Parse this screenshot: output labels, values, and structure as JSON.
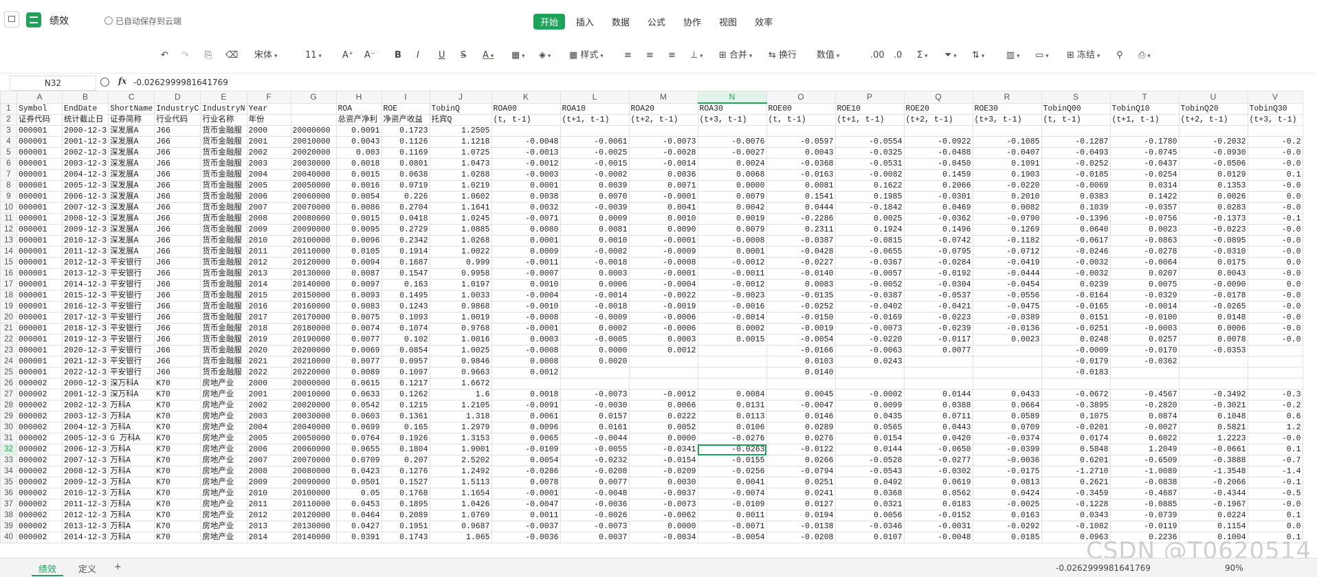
{
  "doc": {
    "title": "绩效",
    "save_status": "已自动保存到云端"
  },
  "menu": [
    "开始",
    "插入",
    "数据",
    "公式",
    "协作",
    "视图",
    "效率"
  ],
  "toolbar": {
    "font": "宋体",
    "size": "11",
    "style": "样式",
    "merge": "合并",
    "wrap": "换行",
    "format": "数值",
    "freeze": "冻结"
  },
  "formula": {
    "cell": "N32",
    "value": "-0.0262999981641769"
  },
  "columns": [
    "A",
    "B",
    "C",
    "D",
    "E",
    "F",
    "G",
    "H",
    "I",
    "J",
    "K",
    "L",
    "M",
    "N",
    "O",
    "P",
    "Q",
    "R",
    "S",
    "T",
    "U",
    "V"
  ],
  "rows": [
    [
      "1",
      "Symbol",
      "EndDate",
      "ShortName",
      "IndustryC",
      "IndustryN",
      "Year",
      "",
      "ROA",
      "ROE",
      "TobinQ",
      "ROA00",
      "ROA10",
      "ROA20",
      "ROA30",
      "ROE00",
      "ROE10",
      "ROE20",
      "ROE30",
      "TobinQ00",
      "TobinQ10",
      "TobinQ20",
      "TobinQ30"
    ],
    [
      "2",
      "证券代码",
      "统计截止日",
      "证券简称",
      "行业代码",
      "行业名称",
      "年份",
      "",
      "总资产净利",
      "净资产收益",
      "托宾Q",
      "(t, t-1)",
      "(t+1, t-1)",
      "(t+2, t-1)",
      "(t+3, t-1)",
      "(t, t-1)",
      "(t+1, t-1)",
      "(t+2, t-1)",
      "(t+3, t-1)",
      "(t, t-1)",
      "(t+1, t-1)",
      "(t+2, t-1)",
      "(t+3, t-1)"
    ],
    [
      "3",
      "000001",
      "2000-12-3",
      "深发展A",
      "J66",
      "货币金融服",
      "2000",
      "20000000",
      "0.0091",
      "0.1723",
      "1.2505",
      "",
      "",
      "",
      "",
      "",
      "",
      "",
      "",
      "",
      "",
      "",
      ""
    ],
    [
      "4",
      "000001",
      "2001-12-3",
      "深发展A",
      "J66",
      "货币金融服",
      "2001",
      "20010000",
      "0.0043",
      "0.1126",
      "1.1218",
      "-0.0048",
      "-0.0061",
      "-0.0073",
      "-0.0076",
      "-0.0597",
      "-0.0554",
      "-0.0922",
      "-0.1085",
      "-0.1287",
      "-0.1780",
      "-0.2032",
      "-0.2"
    ],
    [
      "5",
      "000001",
      "2002-12-3",
      "深发展A",
      "J66",
      "货币金融服",
      "2002",
      "20020000",
      "0.003",
      "0.1169",
      "1.0725",
      "-0.0013",
      "-0.0025",
      "-0.0028",
      "-0.0027",
      "0.0043",
      "-0.0325",
      "-0.0488",
      "-0.0407",
      "-0.0493",
      "-0.0745",
      "-0.0930",
      "-0.0"
    ],
    [
      "6",
      "000001",
      "2003-12-3",
      "深发展A",
      "J66",
      "货币金融服",
      "2003",
      "20030000",
      "0.0018",
      "0.0801",
      "1.0473",
      "-0.0012",
      "-0.0015",
      "-0.0014",
      "0.0024",
      "-0.0368",
      "-0.0531",
      "-0.0450",
      "0.1091",
      "-0.0252",
      "-0.0437",
      "-0.0506",
      "-0.0"
    ],
    [
      "7",
      "000001",
      "2004-12-3",
      "深发展A",
      "J66",
      "货币金融服",
      "2004",
      "20040000",
      "0.0015",
      "0.0638",
      "1.0288",
      "-0.0003",
      "-0.0002",
      "0.0036",
      "0.0068",
      "-0.0163",
      "-0.0082",
      "0.1459",
      "0.1903",
      "-0.0185",
      "-0.0254",
      "0.0129",
      "0.1"
    ],
    [
      "8",
      "000001",
      "2005-12-3",
      "深发展A",
      "J66",
      "货币金融服",
      "2005",
      "20050000",
      "0.0016",
      "0.0719",
      "1.0219",
      "0.0001",
      "0.0039",
      "0.0071",
      "0.0000",
      "0.0081",
      "0.1622",
      "0.2066",
      "-0.0220",
      "-0.0069",
      "0.0314",
      "0.1353",
      "-0.0"
    ],
    [
      "9",
      "000001",
      "2006-12-3",
      "深发展A",
      "J66",
      "货币金融服",
      "2006",
      "20060000",
      "0.0054",
      "0.226",
      "1.0602",
      "0.0038",
      "0.0070",
      "-0.0001",
      "0.0079",
      "0.1541",
      "0.1985",
      "-0.0301",
      "0.2010",
      "0.0383",
      "0.1422",
      "0.0026",
      "0.0"
    ],
    [
      "10",
      "000001",
      "2007-12-3",
      "深发展A",
      "J66",
      "货币金融服",
      "2007",
      "20070000",
      "0.0086",
      "0.2704",
      "1.1641",
      "0.0032",
      "-0.0039",
      "0.0041",
      "0.0042",
      "0.0444",
      "-0.1842",
      "0.0469",
      "0.0082",
      "0.1039",
      "-0.0357",
      "0.0283",
      "-0.0"
    ],
    [
      "11",
      "000001",
      "2008-12-3",
      "深发展A",
      "J66",
      "货币金融服",
      "2008",
      "20080000",
      "0.0015",
      "0.0418",
      "1.0245",
      "-0.0071",
      "0.0009",
      "0.0010",
      "0.0019",
      "-0.2286",
      "0.0025",
      "-0.0362",
      "-0.0790",
      "-0.1396",
      "-0.0756",
      "-0.1373",
      "-0.1"
    ],
    [
      "12",
      "000001",
      "2009-12-3",
      "深发展A",
      "J66",
      "货币金融服",
      "2009",
      "20090000",
      "0.0095",
      "0.2729",
      "1.0885",
      "0.0080",
      "0.0081",
      "0.0090",
      "0.0079",
      "0.2311",
      "0.1924",
      "0.1496",
      "0.1269",
      "0.0640",
      "0.0023",
      "-0.0223",
      "-0.0"
    ],
    [
      "13",
      "000001",
      "2010-12-3",
      "深发展A",
      "J66",
      "货币金融服",
      "2010",
      "20100000",
      "0.0096",
      "0.2342",
      "1.0268",
      "0.0001",
      "0.0010",
      "-0.0001",
      "-0.0008",
      "-0.0387",
      "-0.0815",
      "-0.0742",
      "-0.1182",
      "-0.0617",
      "-0.0863",
      "-0.0895",
      "-0.0"
    ],
    [
      "14",
      "000001",
      "2011-12-3",
      "深发展A",
      "J66",
      "货币金融服",
      "2011",
      "20110000",
      "0.0105",
      "0.1914",
      "1.0022",
      "0.0009",
      "-0.0002",
      "-0.0009",
      "0.0001",
      "-0.0428",
      "-0.0655",
      "-0.0795",
      "-0.0712",
      "-0.0246",
      "-0.0278",
      "-0.0310",
      "-0.0"
    ],
    [
      "15",
      "000001",
      "2012-12-3",
      "平安银行",
      "J66",
      "货币金融服",
      "2012",
      "20120000",
      "0.0094",
      "0.1687",
      "0.999",
      "-0.0011",
      "-0.0018",
      "-0.0008",
      "-0.0012",
      "-0.0227",
      "-0.0367",
      "-0.0284",
      "-0.0419",
      "-0.0032",
      "-0.0064",
      "0.0175",
      "0.0"
    ],
    [
      "16",
      "000001",
      "2013-12-3",
      "平安银行",
      "J66",
      "货币金融服",
      "2013",
      "20130000",
      "0.0087",
      "0.1547",
      "0.9958",
      "-0.0007",
      "0.0003",
      "-0.0001",
      "-0.0011",
      "-0.0140",
      "-0.0057",
      "-0.0192",
      "-0.0444",
      "-0.0032",
      "0.0207",
      "0.0043",
      "-0.0"
    ],
    [
      "17",
      "000001",
      "2014-12-3",
      "平安银行",
      "J66",
      "货币金融服",
      "2014",
      "20140000",
      "0.0097",
      "0.163",
      "1.0197",
      "0.0010",
      "0.0006",
      "-0.0004",
      "-0.0012",
      "0.0083",
      "-0.0052",
      "-0.0304",
      "-0.0454",
      "0.0239",
      "0.0075",
      "-0.0090",
      "0.0"
    ],
    [
      "18",
      "000001",
      "2015-12-3",
      "平安银行",
      "J66",
      "货币金融服",
      "2015",
      "20150000",
      "0.0093",
      "0.1495",
      "1.0033",
      "-0.0004",
      "-0.0014",
      "-0.0022",
      "-0.0023",
      "-0.0135",
      "-0.0387",
      "-0.0537",
      "-0.0556",
      "-0.0164",
      "-0.0329",
      "-0.0178",
      "-0.0"
    ],
    [
      "19",
      "000001",
      "2016-12-3",
      "平安银行",
      "J66",
      "货币金融服",
      "2016",
      "20160000",
      "0.0083",
      "0.1243",
      "0.9868",
      "-0.0010",
      "-0.0018",
      "-0.0019",
      "-0.0016",
      "-0.0252",
      "-0.0402",
      "-0.0421",
      "-0.0475",
      "-0.0165",
      "-0.0014",
      "-0.0265",
      "-0.0"
    ],
    [
      "20",
      "000001",
      "2017-12-3",
      "平安银行",
      "J66",
      "货币金融服",
      "2017",
      "20170000",
      "0.0075",
      "0.1093",
      "1.0019",
      "-0.0008",
      "-0.0009",
      "-0.0006",
      "-0.0014",
      "-0.0150",
      "-0.0169",
      "-0.0223",
      "-0.0389",
      "0.0151",
      "-0.0100",
      "0.0148",
      "-0.0"
    ],
    [
      "21",
      "000001",
      "2018-12-3",
      "平安银行",
      "J66",
      "货币金融服",
      "2018",
      "20180000",
      "0.0074",
      "0.1074",
      "0.9768",
      "-0.0001",
      "0.0002",
      "-0.0006",
      "0.0002",
      "-0.0019",
      "-0.0073",
      "-0.0239",
      "-0.0136",
      "-0.0251",
      "-0.0003",
      "0.0006",
      "-0.0"
    ],
    [
      "22",
      "000001",
      "2019-12-3",
      "平安银行",
      "J66",
      "货币金融服",
      "2019",
      "20190000",
      "0.0077",
      "0.102",
      "1.0016",
      "0.0003",
      "-0.0005",
      "0.0003",
      "0.0015",
      "-0.0054",
      "-0.0220",
      "-0.0117",
      "0.0023",
      "0.0248",
      "0.0257",
      "0.0078",
      "-0.0"
    ],
    [
      "23",
      "000001",
      "2020-12-3",
      "平安银行",
      "J66",
      "货币金融服",
      "2020",
      "20200000",
      "0.0069",
      "0.0854",
      "1.0025",
      "-0.0008",
      "0.0000",
      "0.0012",
      "",
      "-0.0166",
      "-0.0063",
      "0.0077",
      "",
      "-0.0009",
      "-0.0170",
      "-0.0353",
      ""
    ],
    [
      "24",
      "000001",
      "2021-12-3",
      "平安银行",
      "J66",
      "货币金融服",
      "2021",
      "20210000",
      "0.0077",
      "0.0957",
      "0.9846",
      "0.0008",
      "0.0020",
      "",
      "",
      "0.0103",
      "0.0243",
      "",
      "",
      "-0.0179",
      "-0.0362",
      "",
      ""
    ],
    [
      "25",
      "000001",
      "2022-12-3",
      "平安银行",
      "J66",
      "货币金融服",
      "2022",
      "20220000",
      "0.0089",
      "0.1097",
      "0.9663",
      "0.0012",
      "",
      "",
      "",
      "0.0140",
      "",
      "",
      "",
      "-0.0183",
      "",
      "",
      ""
    ],
    [
      "26",
      "000002",
      "2000-12-3",
      "深万科A",
      "K70",
      "房地产业",
      "2000",
      "20000000",
      "0.0615",
      "0.1217",
      "1.6672",
      "",
      "",
      "",
      "",
      "",
      "",
      "",
      "",
      "",
      "",
      "",
      ""
    ],
    [
      "27",
      "000002",
      "2001-12-3",
      "深万科A",
      "K70",
      "房地产业",
      "2001",
      "20010000",
      "0.0633",
      "0.1262",
      "1.6",
      "0.0018",
      "-0.0073",
      "-0.0012",
      "0.0084",
      "0.0045",
      "-0.0002",
      "0.0144",
      "0.0433",
      "-0.0672",
      "-0.4567",
      "-0.3492",
      "-0.3"
    ],
    [
      "28",
      "000002",
      "2002-12-3",
      "万科A",
      "K70",
      "房地产业",
      "2002",
      "20020000",
      "0.0542",
      "0.1215",
      "1.2105",
      "-0.0091",
      "-0.0030",
      "0.0066",
      "0.0131",
      "-0.0047",
      "0.0099",
      "0.0388",
      "0.0664",
      "-0.3895",
      "-0.2820",
      "-0.3021",
      "-0.2"
    ],
    [
      "29",
      "000002",
      "2003-12-3",
      "万科A",
      "K70",
      "房地产业",
      "2003",
      "20030000",
      "0.0603",
      "0.1361",
      "1.318",
      "0.0061",
      "0.0157",
      "0.0222",
      "0.0113",
      "0.0146",
      "0.0435",
      "0.0711",
      "0.0589",
      "0.1075",
      "0.0874",
      "0.1048",
      "0.6"
    ],
    [
      "30",
      "000002",
      "2004-12-3",
      "万科A",
      "K70",
      "房地产业",
      "2004",
      "20040000",
      "0.0699",
      "0.165",
      "1.2979",
      "0.0096",
      "0.0161",
      "0.0052",
      "0.0106",
      "0.0289",
      "0.0565",
      "0.0443",
      "0.0709",
      "-0.0201",
      "-0.0027",
      "0.5821",
      "1.2"
    ],
    [
      "31",
      "000002",
      "2005-12-3",
      "G 万科A",
      "K70",
      "房地产业",
      "2005",
      "20050000",
      "0.0764",
      "0.1926",
      "1.3153",
      "0.0065",
      "-0.0044",
      "0.0000",
      "-0.0276",
      "0.0276",
      "0.0154",
      "0.0420",
      "-0.0374",
      "0.0174",
      "0.6022",
      "1.2223",
      "-0.0"
    ],
    [
      "32",
      "000002",
      "2006-12-3",
      "万科A",
      "K70",
      "房地产业",
      "2006",
      "20060000",
      "0.0655",
      "0.1804",
      "1.9001",
      "-0.0109",
      "-0.0055",
      "-0.0341",
      "-0.0263",
      "-0.0122",
      "0.0144",
      "-0.0650",
      "-0.0399",
      "0.5848",
      "1.2049",
      "-0.0661",
      "0.1"
    ],
    [
      "33",
      "000002",
      "2007-12-3",
      "万科A",
      "K70",
      "房地产业",
      "2007",
      "20070000",
      "0.0709",
      "0.207",
      "2.5202",
      "0.0054",
      "-0.0232",
      "-0.0154",
      "-0.0155",
      "0.0266",
      "-0.0528",
      "-0.0277",
      "-0.0036",
      "0.6201",
      "-0.6509",
      "-0.3888",
      "-0.7"
    ],
    [
      "34",
      "000002",
      "2008-12-3",
      "万科A",
      "K70",
      "房地产业",
      "2008",
      "20080000",
      "0.0423",
      "0.1276",
      "1.2492",
      "-0.0286",
      "-0.0208",
      "-0.0209",
      "-0.0256",
      "-0.0794",
      "-0.0543",
      "-0.0302",
      "-0.0175",
      "-1.2710",
      "-1.0089",
      "-1.3548",
      "-1.4"
    ],
    [
      "35",
      "000002",
      "2009-12-3",
      "万科A",
      "K70",
      "房地产业",
      "2009",
      "20090000",
      "0.0501",
      "0.1527",
      "1.5113",
      "0.0078",
      "0.0077",
      "0.0030",
      "0.0041",
      "0.0251",
      "0.0492",
      "0.0619",
      "0.0813",
      "0.2621",
      "-0.0838",
      "-0.2066",
      "-0.1"
    ],
    [
      "36",
      "000002",
      "2010-12-3",
      "万科A",
      "K70",
      "房地产业",
      "2010",
      "20100000",
      "0.05",
      "0.1768",
      "1.1654",
      "-0.0001",
      "-0.0048",
      "-0.0037",
      "-0.0074",
      "0.0241",
      "0.0368",
      "0.0562",
      "0.0424",
      "-0.3459",
      "-0.4687",
      "-0.4344",
      "-0.5"
    ],
    [
      "37",
      "000002",
      "2011-12-3",
      "万科A",
      "K70",
      "房地产业",
      "2011",
      "20110000",
      "0.0453",
      "0.1895",
      "1.0426",
      "-0.0047",
      "-0.0036",
      "-0.0073",
      "-0.0109",
      "0.0127",
      "0.0321",
      "0.0183",
      "-0.0025",
      "-0.1228",
      "-0.0885",
      "-0.1967",
      "-0.0"
    ],
    [
      "38",
      "000002",
      "2012-12-3",
      "万科A",
      "K70",
      "房地产业",
      "2012",
      "20120000",
      "0.0464",
      "0.2089",
      "1.0769",
      "0.0011",
      "-0.0026",
      "-0.0062",
      "0.0011",
      "0.0194",
      "0.0056",
      "-0.0152",
      "0.0163",
      "0.0343",
      "-0.0739",
      "0.0224",
      "0.1"
    ],
    [
      "39",
      "000002",
      "2013-12-3",
      "万科A",
      "K70",
      "房地产业",
      "2013",
      "20130000",
      "0.0427",
      "0.1951",
      "0.9687",
      "-0.0037",
      "-0.0073",
      "0.0000",
      "-0.0071",
      "-0.0138",
      "-0.0346",
      "-0.0031",
      "-0.0292",
      "-0.1082",
      "-0.0119",
      "0.1154",
      "0.0"
    ],
    [
      "40",
      "000002",
      "2014-12-3",
      "万科A",
      "K70",
      "房地产业",
      "2014",
      "20140000",
      "0.0391",
      "0.1743",
      "1.065",
      "-0.0036",
      "0.0037",
      "-0.0034",
      "-0.0054",
      "-0.0208",
      "0.0107",
      "-0.0048",
      "0.0185",
      "0.0963",
      "0.2236",
      "0.1004",
      "0.1"
    ]
  ],
  "sheets": [
    "绩效",
    "定义"
  ],
  "status": {
    "value": "-0.0262999981641769",
    "zoom": "90%"
  },
  "watermark": "CSDN @T0620514"
}
